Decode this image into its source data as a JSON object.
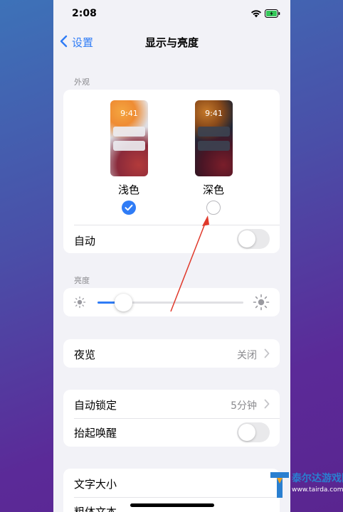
{
  "status_bar": {
    "time": "2:08"
  },
  "nav": {
    "back_label": "设置",
    "title": "显示与亮度"
  },
  "appearance": {
    "header": "外观",
    "light": {
      "preview_time": "9:41",
      "label": "浅色",
      "selected": true
    },
    "dark": {
      "preview_time": "9:41",
      "label": "深色",
      "selected": false
    },
    "auto_label": "自动",
    "auto_on": false
  },
  "brightness": {
    "header": "亮度",
    "level": 0.18
  },
  "night_shift": {
    "label": "夜览",
    "value": "关闭"
  },
  "lock": {
    "auto_lock_label": "自动锁定",
    "auto_lock_value": "5分钟",
    "raise_to_wake_label": "抬起唤醒",
    "raise_to_wake_on": false
  },
  "text": {
    "text_size_label": "文字大小",
    "bold_text_label": "粗体文本"
  },
  "watermark": {
    "name": "泰尔达游戏网",
    "url": "www.tairda.com"
  },
  "colors": {
    "accent": "#2f7cf6",
    "annotation_arrow": "#e0392b"
  }
}
